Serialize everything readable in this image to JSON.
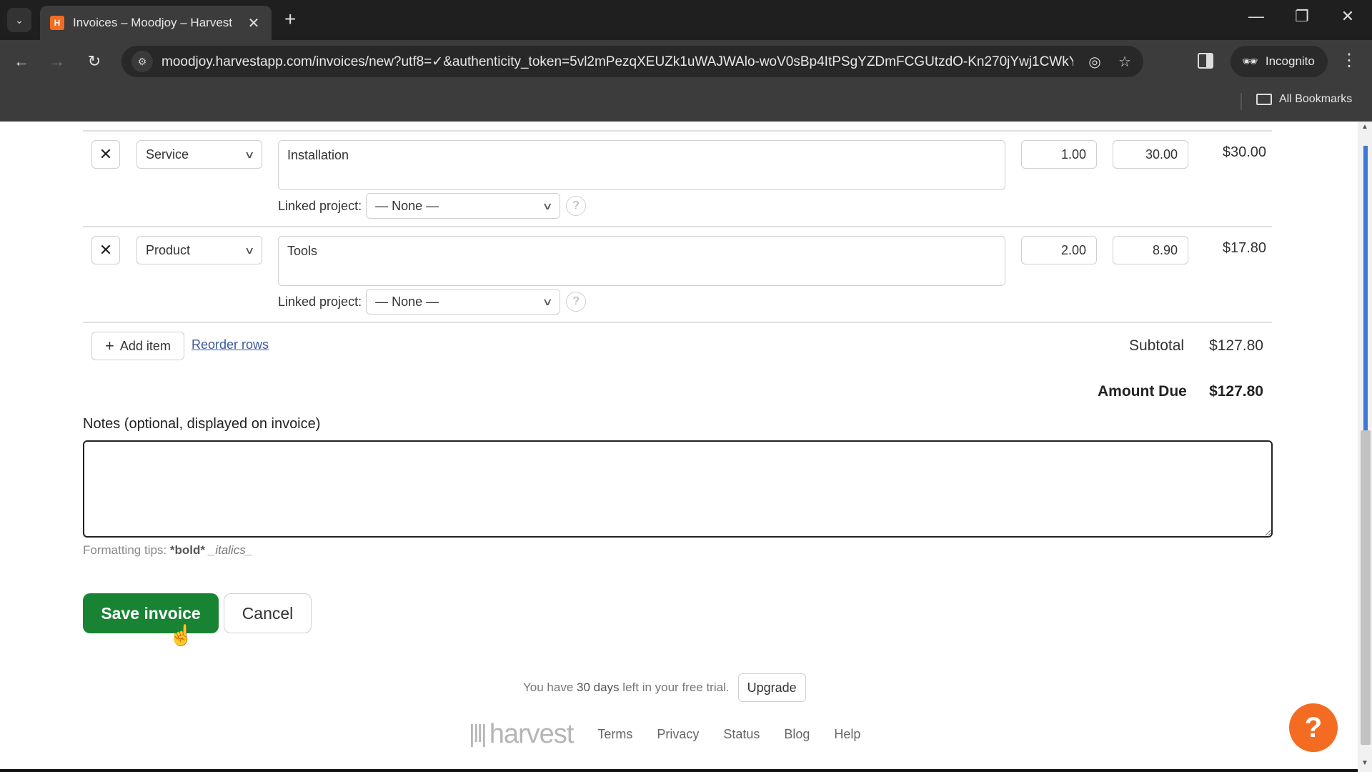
{
  "browser": {
    "tab_title": "Invoices – Moodjoy – Harvest",
    "favicon_letter": "H",
    "new_tab": "+",
    "url": "moodjoy.harvestapp.com/invoices/new?utf8=✓&authenticity_token=5vl2mPezqXEUZk1uWAJWAlo-woV0sBp4ItPSgYZDmFCGUtzdO-Kn270jYwj1CWkYh...",
    "incognito_label": "Incognito",
    "all_bookmarks_label": "All Bookmarks"
  },
  "line_items": [
    {
      "kind": "Service",
      "description": "Installation",
      "quantity": "1.00",
      "unit_price": "30.00",
      "amount": "$30.00",
      "linked_project_label": "Linked project:",
      "linked_project": "— None —"
    },
    {
      "kind": "Product",
      "description": "Tools",
      "quantity": "2.00",
      "unit_price": "8.90",
      "amount": "$17.80",
      "linked_project_label": "Linked project:",
      "linked_project": "— None —"
    }
  ],
  "actions": {
    "add_item": "Add item",
    "reorder_rows": "Reorder rows"
  },
  "totals": {
    "subtotal_label": "Subtotal",
    "subtotal": "$127.80",
    "amount_due_label": "Amount Due",
    "amount_due": "$127.80"
  },
  "notes": {
    "label": "Notes (optional, displayed on invoice)",
    "value": "",
    "tips_prefix": "Formatting tips:",
    "tips_bold": "*bold*",
    "tips_italic": "_italics_"
  },
  "buttons": {
    "save": "Save invoice",
    "cancel": "Cancel"
  },
  "trial": {
    "prefix": "You have",
    "days": "30 days",
    "suffix": "left in your free trial.",
    "upgrade": "Upgrade"
  },
  "footer": {
    "logo_text": "harvest",
    "links": [
      "Terms",
      "Privacy",
      "Status",
      "Blog",
      "Help"
    ]
  },
  "help_fab": "?"
}
